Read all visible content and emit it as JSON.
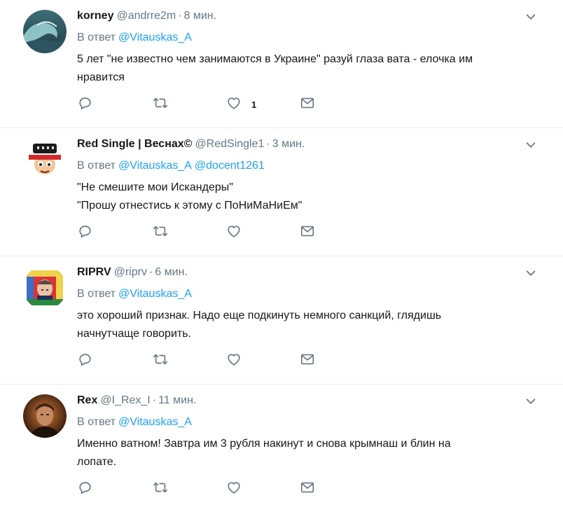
{
  "reply_prefix": "В ответ",
  "colors": {
    "accent": "#1da1f2",
    "muted": "#657786",
    "text": "#14171a",
    "divider": "#e6ecf0"
  },
  "icons": {
    "reply": "reply-icon",
    "retweet": "retweet-icon",
    "like": "heart-icon",
    "dm": "envelope-icon",
    "more": "chevron-down-icon"
  },
  "tweets": [
    {
      "name": "korney",
      "handle": "@andrre2m",
      "time": "8 мин.",
      "reply_to": [
        "@Vitauskas_A"
      ],
      "text": [
        "5 лет \"не известно чем занимаются в Украине\" разуй глаза вата - елочка им",
        "нравится"
      ],
      "likes": "1",
      "avatar": "wave"
    },
    {
      "name": "Red Single | Веснах©",
      "handle": "@RedSingle1",
      "time": "3 мин.",
      "reply_to": [
        "@Vitauskas_A",
        "@docent1261"
      ],
      "text": [
        "\"Не смешите мои Искандеры\"",
        "\"Прошу отнестись к этому с ПоНиМаНиЕм\""
      ],
      "likes": "",
      "avatar": "cartoon"
    },
    {
      "name": "RIPRV",
      "handle": "@riprv",
      "time": "6 мин.",
      "reply_to": [
        "@Vitauskas_A"
      ],
      "text": [
        "это хороший признак. Надо еще подкинуть немного санкций, глядишь",
        "начнутчаще говорить."
      ],
      "likes": "",
      "avatar": "poster"
    },
    {
      "name": "Rex",
      "handle": "@I_Rex_I",
      "time": "11 мин.",
      "reply_to": [
        "@Vitauskas_A"
      ],
      "text": [
        "Именно ватном! Завтра им 3 рубля накинут и снова крымнаш и блин на",
        "лопате."
      ],
      "likes": "",
      "avatar": "portrait"
    }
  ]
}
